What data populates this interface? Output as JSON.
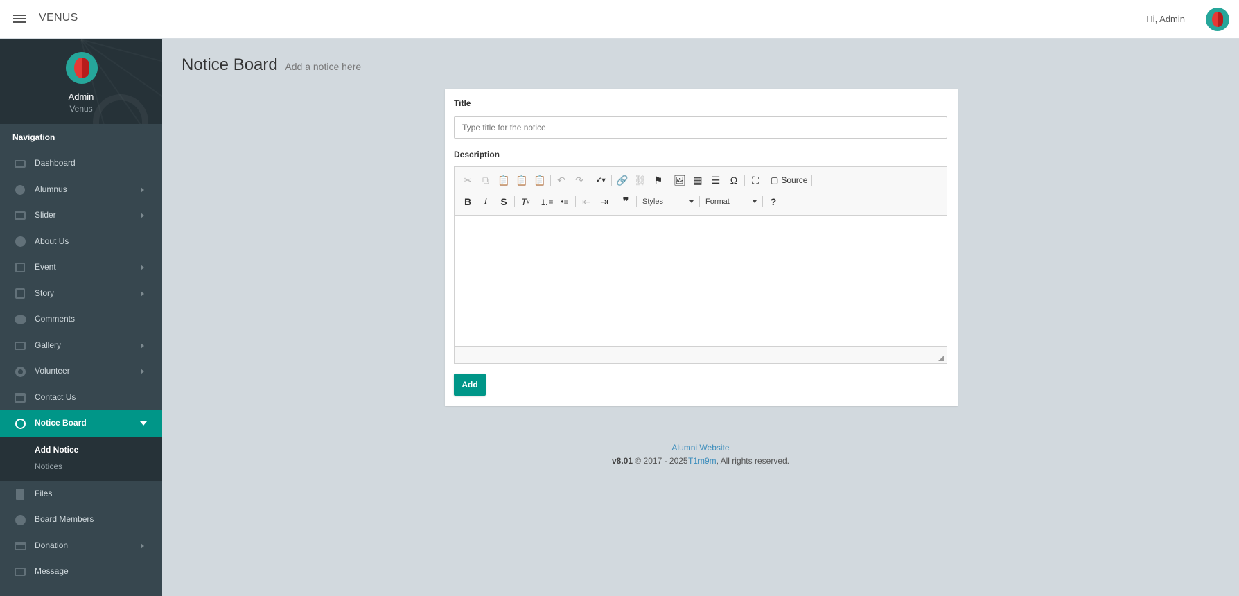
{
  "app": {
    "brand": "VENUS",
    "greeting": "Hi, Admin"
  },
  "colors": {
    "accent": "#009688",
    "sidebar_bg": "#37474f",
    "sidebar_dark": "#263238",
    "link": "#3c8dbc"
  },
  "profile": {
    "name": "Admin",
    "role": "Venus"
  },
  "sidebar": {
    "header": "Navigation",
    "items": [
      {
        "label": "Dashboard",
        "icon": "laptop-icon",
        "has_submenu": false
      },
      {
        "label": "Alumnus",
        "icon": "user-icon",
        "has_submenu": true
      },
      {
        "label": "Slider",
        "icon": "image-icon",
        "has_submenu": true
      },
      {
        "label": "About Us",
        "icon": "info-icon",
        "has_submenu": false
      },
      {
        "label": "Event",
        "icon": "calendar-icon",
        "has_submenu": true
      },
      {
        "label": "Story",
        "icon": "book-icon",
        "has_submenu": true
      },
      {
        "label": "Comments",
        "icon": "comments-icon",
        "has_submenu": false
      },
      {
        "label": "Gallery",
        "icon": "camera-icon",
        "has_submenu": true
      },
      {
        "label": "Volunteer",
        "icon": "life-ring-icon",
        "has_submenu": true
      },
      {
        "label": "Contact Us",
        "icon": "bank-icon",
        "has_submenu": false
      },
      {
        "label": "Notice Board",
        "icon": "podcast-icon",
        "has_submenu": true,
        "active": true
      },
      {
        "label": "Files",
        "icon": "file-icon",
        "has_submenu": false
      },
      {
        "label": "Board Members",
        "icon": "user-circle-icon",
        "has_submenu": false
      },
      {
        "label": "Donation",
        "icon": "credit-card-icon",
        "has_submenu": true
      },
      {
        "label": "Message",
        "icon": "envelope-icon",
        "has_submenu": false
      }
    ],
    "notice_sub": [
      {
        "label": "Add Notice",
        "current": true
      },
      {
        "label": "Notices",
        "current": false
      }
    ]
  },
  "page": {
    "title": "Notice Board",
    "subtitle": "Add a notice here"
  },
  "form": {
    "title_label": "Title",
    "title_placeholder": "Type title for the notice",
    "title_value": "",
    "description_label": "Description",
    "add_label": "Add"
  },
  "editor": {
    "source_label": "Source",
    "styles_label": "Styles",
    "format_label": "Format"
  },
  "footer": {
    "site": "Alumni Website",
    "version": "v8.01",
    "copyright": "© 2017 - 2025",
    "author": "T1m9m",
    "rights": ", All rights reserved."
  }
}
